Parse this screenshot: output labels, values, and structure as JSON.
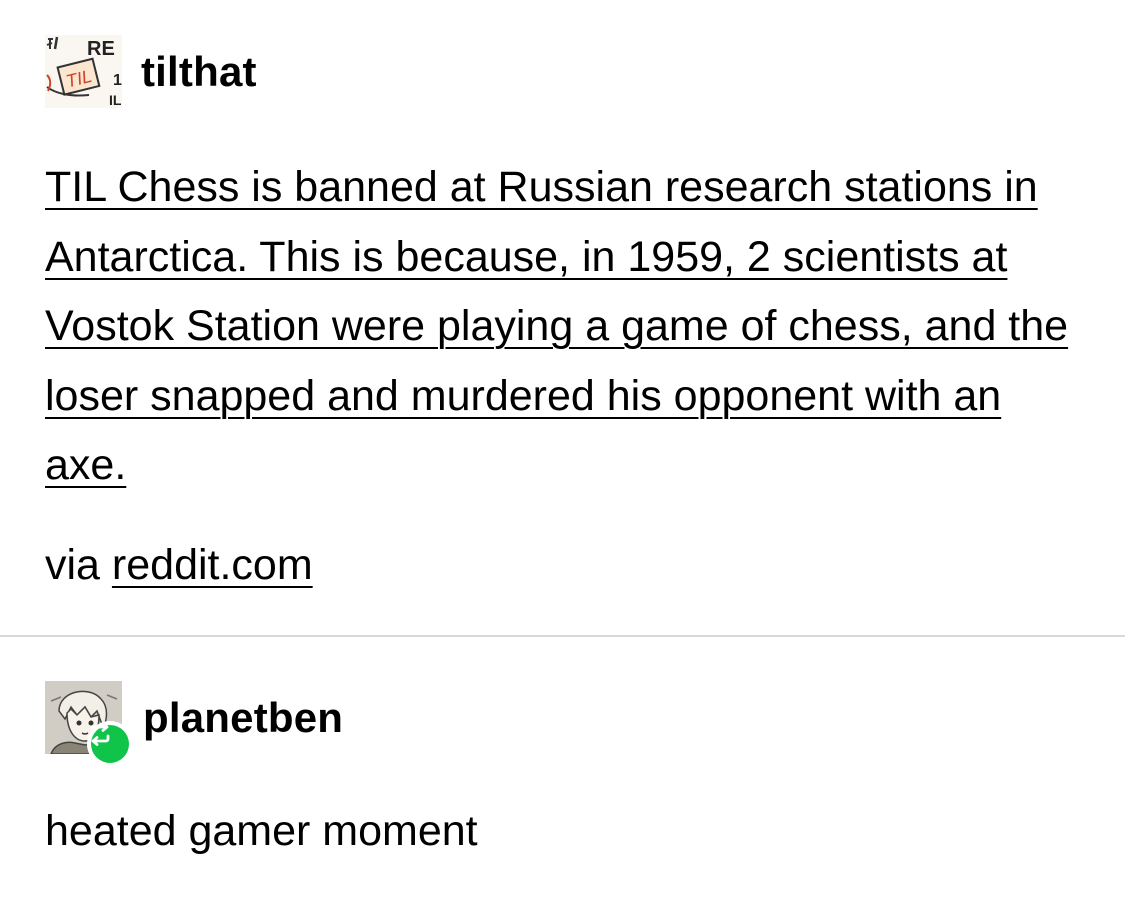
{
  "posts": [
    {
      "username": "tilthat",
      "avatar_icon": "til-reddit-avatar-icon",
      "title": "TIL Chess is banned at Russian research stations in Antarctica. This is because, in 1959, 2 scientists at Vostok Station were playing a game of chess, and the loser snapped and murdered his opponent with an axe.",
      "source_prefix": "via",
      "source_link": "reddit.com",
      "avatar_text": [
        "RE",
        "TIL",
        "1",
        "IL"
      ]
    },
    {
      "username": "planetben",
      "avatar_icon": "anime-character-avatar-icon",
      "badge_icon": "reblog-icon",
      "comment": "heated gamer moment"
    }
  ],
  "colors": {
    "reblog_badge": "#10c44a",
    "divider": "#d9d9d9",
    "text": "#000000"
  }
}
